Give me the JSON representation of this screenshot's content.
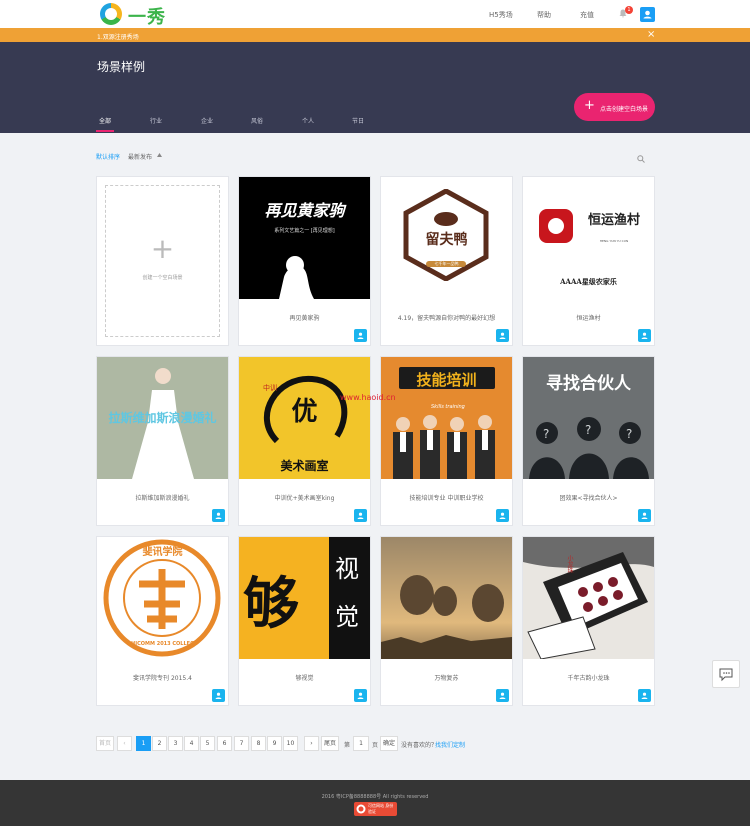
{
  "header": {
    "logo_text": "一秀",
    "nav": [
      "H5秀场",
      "帮助",
      "充值"
    ],
    "notification_count": "1"
  },
  "notice": {
    "text": "1.双源注册秀场",
    "close": "×"
  },
  "hero": {
    "title": "场景样例",
    "create_button": "点击创建空白场景"
  },
  "tabs": [
    "全部",
    "行业",
    "企业",
    "风俗",
    "个人",
    "节日"
  ],
  "sort": {
    "default": "默认排序",
    "latest": "最新发布"
  },
  "create_card": {
    "label": "创建一个空白场景"
  },
  "cards": [
    {
      "name": "再见黄家驹",
      "thumb_title": "再见黄家驹",
      "thumb_sub": "系列文艺篇之一 [再见理想]"
    },
    {
      "name": "4.19，留夫鸭源自你对鸭的最好幻想",
      "thumb_title": "留夫鸭",
      "thumb_sub": "七千年一品鸭"
    },
    {
      "name": "恒运渔村",
      "thumb_title": "恒运渔村",
      "thumb_sub": "HENG YUN YU CUN",
      "thumb_foot": "AAAA星级农家乐"
    },
    {
      "name": "拉斯维加斯浪漫婚礼",
      "thumb_title": "拉斯维加斯浪漫婚礼"
    },
    {
      "name": "中训优+美术画室king",
      "thumb_title": "优",
      "thumb_sub": "美术画室",
      "thumb_tag": "中训"
    },
    {
      "name": "技能培训专业 中训职业学校",
      "thumb_title": "技能培训",
      "thumb_sub": "Skills training"
    },
    {
      "name": "团效果<寻找合伙人>",
      "thumb_title": "寻找合伙人"
    },
    {
      "name": "斐讯学院专刊 2015.4",
      "thumb_title": "斐讯学院",
      "thumb_sub": "PHICOMM 2013 COLLEGE"
    },
    {
      "name": "够视觉",
      "thumb_title": "够",
      "thumb_sub": "视觉"
    },
    {
      "name": "万物复苏",
      "thumb_title": ""
    },
    {
      "name": "千年古韵小龙珠",
      "thumb_title": "小龙珠"
    }
  ],
  "watermark": "www.haoid.cn",
  "pagination": {
    "first": "首页",
    "prev": "‹",
    "pages": [
      "1",
      "2",
      "3",
      "4",
      "5",
      "6",
      "7",
      "8",
      "9",
      "10"
    ],
    "next": "›",
    "last": "尾页",
    "goto_pre": "第",
    "goto_value": "1",
    "goto_post": "页",
    "goto_btn": "确定",
    "hint_pre": "没有喜欢的？",
    "hint_link": "找我们定制"
  },
  "footer": {
    "copyright": "2016 粤ICP备8888888号 All rights reserved",
    "badge": "可信网站 身份验证"
  },
  "colors": {
    "accent": "#1a9ef5",
    "pink": "#ea2470",
    "hero_bg": "#373a52",
    "notice": "#efa135"
  }
}
